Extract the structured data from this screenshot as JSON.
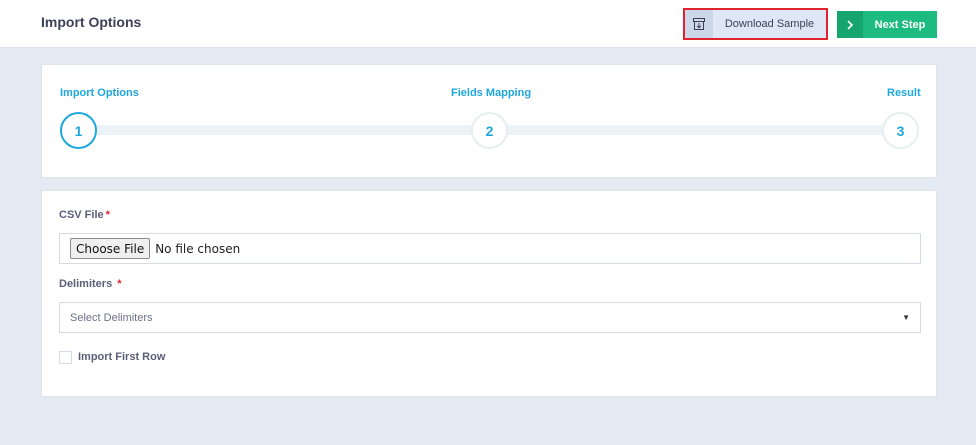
{
  "header": {
    "title": "Import Options",
    "download_label": "Download Sample",
    "download_icon": "archive-download-icon",
    "next_label": "Next Step",
    "next_icon": "chevron-right-icon"
  },
  "stepper": {
    "steps": [
      {
        "label": "Import Options",
        "number": "1",
        "state": "active"
      },
      {
        "label": "Fields Mapping",
        "number": "2",
        "state": "pending"
      },
      {
        "label": "Result",
        "number": "3",
        "state": "pending"
      }
    ]
  },
  "form": {
    "csv_label": "CSV File",
    "required_mark": "*",
    "choose_file_label": "Choose File",
    "file_status": "No file chosen",
    "delimiters_label": "Delimiters",
    "delimiters_placeholder": "Select Delimiters",
    "import_first_row_label": "Import First Row",
    "import_first_row_checked": false
  },
  "colors": {
    "accent": "#1ea7dd",
    "success": "#1dbb80",
    "required": "#e0242e",
    "background": "#e4eaf2"
  }
}
